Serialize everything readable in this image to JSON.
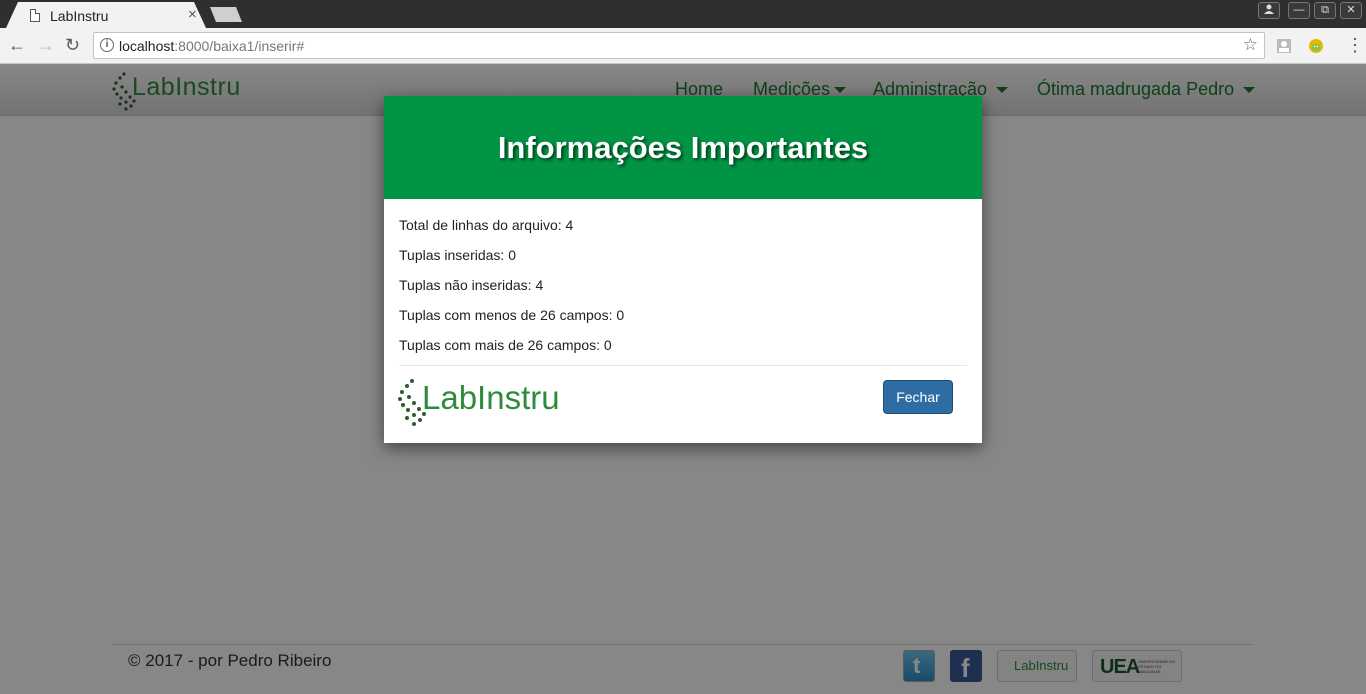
{
  "browser": {
    "tab_title": "LabInstru",
    "tab_close": "×",
    "url_host": "localhost",
    "url_path": ":8000/baixa1/inserir#",
    "window_controls": [
      "profile-icon",
      "minimize-icon",
      "restore-icon",
      "close-icon"
    ],
    "win_glyphs": {
      "minimize": "—",
      "restore": "⧉",
      "close": "✕"
    },
    "nav_glyphs": {
      "back": "←",
      "forward": "→",
      "reload": "↻",
      "star": "☆",
      "menu": "⋮",
      "info": "i"
    }
  },
  "navbar": {
    "brand": "LabInstru",
    "items": [
      {
        "label": "Home",
        "dropdown": false
      },
      {
        "label": "Medições",
        "dropdown": true
      },
      {
        "label": "Administração",
        "dropdown": true
      },
      {
        "label": "Ótima madrugada Pedro",
        "dropdown": true
      }
    ]
  },
  "modal": {
    "title": "Informações Importantes",
    "lines": [
      "Total de linhas do arquivo: 4",
      "Tuplas inseridas: 0",
      "Tuplas não inseridas: 4",
      "Tuplas com menos de 26 campos: 0",
      "Tuplas com mais de 26 campos: 0"
    ],
    "logo_text": "LabInstru",
    "close_button": "Fechar"
  },
  "footer": {
    "copyright": "© 2017 - por Pedro Ribeiro",
    "twitter_glyph": "t",
    "facebook_glyph": "f",
    "labinstru_badge": "LabInstru",
    "uea_text": "UEA",
    "uea_subtext": "UNIVERSIDADE DO ESTADO DO AMAZONAS"
  },
  "colors": {
    "header_green": "#009444",
    "brand_green": "#2e8b3d",
    "button_blue": "#2e6da4"
  }
}
